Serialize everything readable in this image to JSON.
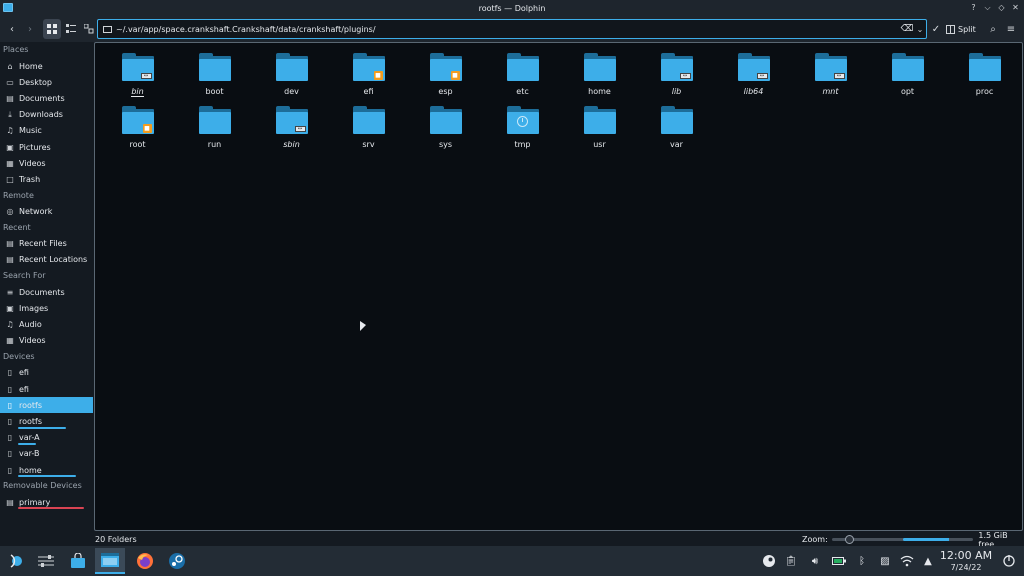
{
  "window": {
    "title": "rootfs — Dolphin"
  },
  "toolbar": {
    "path": "~/.var/app/space.crankshaft.Crankshaft/data/crankshaft/plugins/",
    "split_label": "Split"
  },
  "sidebar": {
    "sections": [
      {
        "title": "Places",
        "items": [
          {
            "label": "Home",
            "icon": "home-icon"
          },
          {
            "label": "Desktop",
            "icon": "desktop-icon"
          },
          {
            "label": "Documents",
            "icon": "documents-icon"
          },
          {
            "label": "Downloads",
            "icon": "downloads-icon"
          },
          {
            "label": "Music",
            "icon": "music-icon"
          },
          {
            "label": "Pictures",
            "icon": "pictures-icon"
          },
          {
            "label": "Videos",
            "icon": "videos-icon"
          },
          {
            "label": "Trash",
            "icon": "trash-icon"
          }
        ]
      },
      {
        "title": "Remote",
        "items": [
          {
            "label": "Network",
            "icon": "network-icon"
          }
        ]
      },
      {
        "title": "Recent",
        "items": [
          {
            "label": "Recent Files",
            "icon": "recent-files-icon"
          },
          {
            "label": "Recent Locations",
            "icon": "recent-locations-icon"
          }
        ]
      },
      {
        "title": "Search For",
        "items": [
          {
            "label": "Documents",
            "icon": "documents-icon"
          },
          {
            "label": "Images",
            "icon": "images-icon"
          },
          {
            "label": "Audio",
            "icon": "audio-icon"
          },
          {
            "label": "Videos",
            "icon": "videos-icon"
          }
        ]
      },
      {
        "title": "Devices",
        "items": [
          {
            "label": "efi",
            "icon": "drive-icon"
          },
          {
            "label": "efi",
            "icon": "drive-icon"
          },
          {
            "label": "rootfs",
            "icon": "drive-icon"
          },
          {
            "label": "rootfs",
            "icon": "drive-icon"
          },
          {
            "label": "var-A",
            "icon": "drive-icon"
          },
          {
            "label": "var-B",
            "icon": "drive-icon"
          },
          {
            "label": "home",
            "icon": "drive-icon"
          }
        ]
      },
      {
        "title": "Removable Devices",
        "items": [
          {
            "label": "primary",
            "icon": "sdcard-icon"
          }
        ]
      }
    ]
  },
  "folders": [
    {
      "name": "bin",
      "italic": true,
      "emblem": "link"
    },
    {
      "name": "boot"
    },
    {
      "name": "dev"
    },
    {
      "name": "efi",
      "emblem": "lock"
    },
    {
      "name": "esp",
      "emblem": "lock"
    },
    {
      "name": "etc"
    },
    {
      "name": "home"
    },
    {
      "name": "lib",
      "italic": true,
      "emblem": "link"
    },
    {
      "name": "lib64",
      "italic": true,
      "emblem": "link"
    },
    {
      "name": "mnt",
      "italic": true,
      "emblem": "link"
    },
    {
      "name": "opt"
    },
    {
      "name": "proc"
    },
    {
      "name": "root",
      "emblem": "lock"
    },
    {
      "name": "run"
    },
    {
      "name": "sbin",
      "italic": true,
      "emblem": "link"
    },
    {
      "name": "srv"
    },
    {
      "name": "sys"
    },
    {
      "name": "tmp",
      "emblem": "clock"
    },
    {
      "name": "usr"
    },
    {
      "name": "var"
    }
  ],
  "status": {
    "count": "20 Folders",
    "zoom_label": "Zoom:",
    "zoom_level": 0.15,
    "free_label": "1.5 GiB free",
    "used_fraction": 0.65
  },
  "taskbar": {
    "time": "12:00 AM",
    "date": "7/24/22"
  },
  "colors": {
    "accent": "#3daee9",
    "folder": "#3daee9",
    "folder_dark": "#1d6d99",
    "lock": "#f39c1f"
  }
}
